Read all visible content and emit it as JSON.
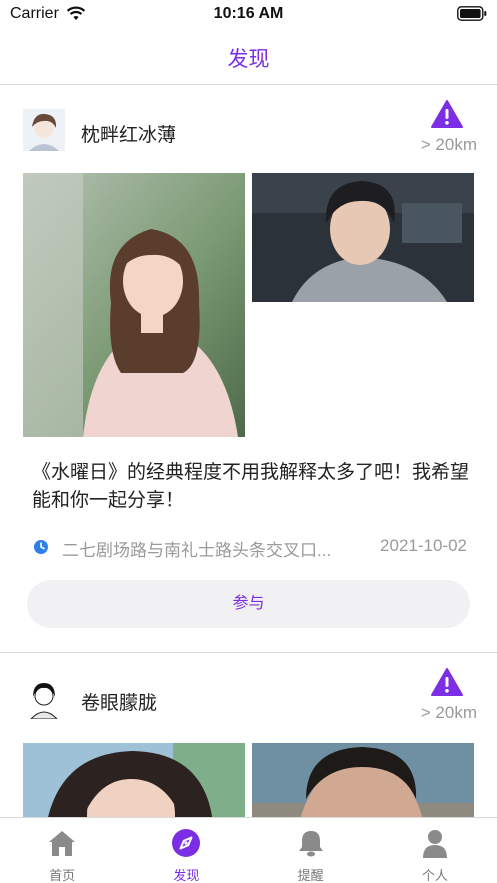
{
  "status_bar": {
    "carrier": "Carrier",
    "time": "10:16 AM"
  },
  "nav": {
    "title": "发现"
  },
  "colors": {
    "accent": "#7b2ee3",
    "text_secondary": "#9a9a9a",
    "button_bg": "#f1f1f3"
  },
  "posts": [
    {
      "user_name": "枕畔红冰薄",
      "distance": "> 20km",
      "text": "《水曜日》的经典程度不用我解释太多了吧！我希望能和你一起分享！",
      "location": "二七剧场路与南礼士路头条交叉口...",
      "date": "2021-10-02",
      "join_label": "参与"
    },
    {
      "user_name": "卷眼朦胧",
      "distance": "> 20km"
    }
  ],
  "tabs": [
    {
      "label": "首页",
      "icon": "home-icon"
    },
    {
      "label": "发现",
      "icon": "compass-icon",
      "active": true
    },
    {
      "label": "提醒",
      "icon": "bell-icon"
    },
    {
      "label": "个人",
      "icon": "person-icon"
    }
  ]
}
